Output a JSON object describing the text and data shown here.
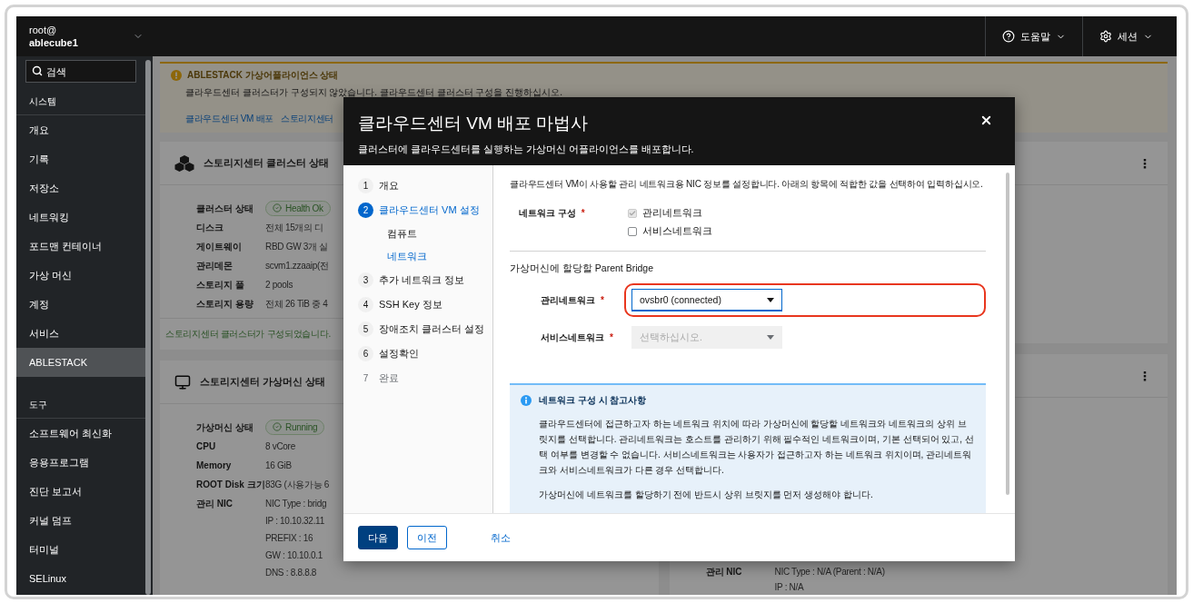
{
  "user": {
    "name": "root@",
    "host": "ablecube1"
  },
  "sidebar": {
    "search": {
      "placeholder": "검색"
    },
    "sections": [
      {
        "title": "시스템",
        "items": [
          {
            "label": "개요",
            "selected": false
          },
          {
            "label": "기록",
            "selected": false
          },
          {
            "label": "저장소",
            "selected": false
          },
          {
            "label": "네트워킹",
            "selected": false
          },
          {
            "label": "포드맨 컨테이너",
            "selected": false
          },
          {
            "label": "가상 머신",
            "selected": false
          },
          {
            "label": "계정",
            "selected": false
          },
          {
            "label": "서비스",
            "selected": false
          },
          {
            "label": "ABLESTACK",
            "selected": true
          }
        ]
      },
      {
        "title": "도구",
        "items": [
          {
            "label": "소프트웨어 최신화",
            "selected": false
          },
          {
            "label": "응용프로그램",
            "selected": false
          },
          {
            "label": "진단 보고서",
            "selected": false
          },
          {
            "label": "커널 덤프",
            "selected": false
          },
          {
            "label": "터미널",
            "selected": false
          },
          {
            "label": "SELinux",
            "selected": false
          }
        ]
      }
    ]
  },
  "topbar": {
    "menus": [
      {
        "kind": "help",
        "label": "도움말"
      },
      {
        "kind": "session",
        "label": "세션"
      }
    ]
  },
  "alert": {
    "title": "ABLESTACK 가상어플라이언스 상태",
    "message": "클라우드센터 클러스터가 구성되지 않았습니다. 클라우드센터 클러스터 구성을 진행하십시오.",
    "links": [
      "클라우드센터 VM 배포",
      "스토리지센터"
    ]
  },
  "cards": [
    {
      "title": "스토리지센터 클러스터 상태",
      "rows": [
        {
          "label": "클러스터 상태",
          "kind": "badge",
          "values": [
            "Health Ok"
          ]
        },
        {
          "label": "디스크",
          "kind": "text",
          "values": [
            "전체 15개의 디"
          ]
        },
        {
          "label": "게이트웨이",
          "kind": "text",
          "values": [
            "RBD GW 3개 실"
          ]
        },
        {
          "label": "관리데몬",
          "kind": "text",
          "values": [
            "scvm1.zzaaip(전"
          ]
        },
        {
          "label": "스토리지 풀",
          "kind": "text",
          "values": [
            "2 pools"
          ]
        },
        {
          "label": "스토리지 용량",
          "kind": "text",
          "values": [
            "전체 26 TiB 중 4"
          ]
        }
      ],
      "footer": "스토리지센터 클러스터가 구성되었습니다."
    },
    {
      "title": "스토리지센터 가상머신 상태",
      "rows": [
        {
          "label": "가상머신 상태",
          "kind": "badge",
          "values": [
            "Running"
          ]
        },
        {
          "label": "CPU",
          "kind": "text",
          "values": [
            "8 vCore"
          ]
        },
        {
          "label": "Memory",
          "kind": "text",
          "values": [
            "16 GiB"
          ]
        },
        {
          "label": "ROOT Disk 크기",
          "kind": "text",
          "values": [
            "83G (사용가능 6"
          ]
        },
        {
          "label": "관리 NIC",
          "kind": "text",
          "values": [
            "NIC Type : bridg",
            "IP : 10.10.32.11",
            "PREFIX : 16",
            "GW : 10.10.0.1",
            "DNS : 8.8.8.8"
          ]
        }
      ]
    },
    {
      "menu": "⋮"
    },
    {
      "menu": "⋮",
      "rows": [
        {
          "label": "관리 NIC",
          "kind": "text",
          "values": [
            "NIC Type : N/A (Parent : N/A)",
            "IP : N/A"
          ]
        }
      ]
    }
  ],
  "wizard": {
    "title": "클라우드센터 VM 배포 마법사",
    "subtitle": "클러스터에 클라우드센터를 실행하는 가상머신 어플라이언스를 배포합니다.",
    "steps": [
      {
        "number": "1",
        "label": "개요",
        "selected": false,
        "disabled": false
      },
      {
        "number": "2",
        "label": "클라우드센터 VM 설정",
        "selected": true,
        "disabled": false,
        "children": [
          {
            "label": "컴퓨트",
            "selected": false
          },
          {
            "label": "네트워크",
            "selected": true
          }
        ]
      },
      {
        "number": "3",
        "label": "추가 네트워크 정보",
        "selected": false,
        "disabled": false
      },
      {
        "number": "4",
        "label": "SSH Key 정보",
        "selected": false,
        "disabled": false
      },
      {
        "number": "5",
        "label": "장애조치 클러스터 설정",
        "selected": false,
        "disabled": false
      },
      {
        "number": "6",
        "label": "설정확인",
        "selected": false,
        "disabled": false
      },
      {
        "number": "7",
        "label": "완료",
        "selected": false,
        "disabled": true
      }
    ],
    "intro": "클라우드센터 VM이 사용할 관리 네트워크용 NIC 정보를 설정합니다. 아래의 항목에 적합한 값을 선택하여 입력하십시오.",
    "network_config": {
      "label": "네트워크 구성",
      "marker": "*",
      "options": [
        {
          "label": "관리네트워크",
          "checked": true,
          "disabled": true
        },
        {
          "label": "서비스네트워크",
          "checked": false,
          "disabled": false
        }
      ]
    },
    "bridge": {
      "title": "가상머신에 할당할 Parent Bridge",
      "fields": [
        {
          "label": "관리네트워크",
          "marker": "*",
          "value": "ovsbr0 (connected)",
          "disabled": false,
          "highlighted": true
        },
        {
          "label": "서비스네트워크",
          "marker": "*",
          "placeholder": "선택하십시오.",
          "disabled": true,
          "highlighted": false
        }
      ]
    },
    "note": {
      "title": "네트워크 구성 시 참고사항",
      "paragraphs": [
        "클라우드센터에 접근하고자 하는 네트워크 위치에 따라 가상머신에 할당할 네트워크와 네트워크의 상위 브릿지를 선택합니다. 관리네트워크는 호스트를 관리하기 위해 필수적인 네트워크이며, 기본 선택되어 있고, 선택 여부를 변경할 수 없습니다. 서비스네트워크는 사용자가 접근하고자 하는 네트워크 위치이며, 관리네트워크와 서비스네트워크가 다른 경우 선택합니다.",
        "가상머신에 네트워크를 할당하기 전에 반드시 상위 브릿지를 먼저 생성해야 합니다."
      ]
    },
    "buttons": [
      {
        "label": "다음",
        "kind": "primary"
      },
      {
        "label": "이전",
        "kind": "secondary"
      },
      {
        "label": "취소",
        "kind": "link"
      }
    ]
  }
}
